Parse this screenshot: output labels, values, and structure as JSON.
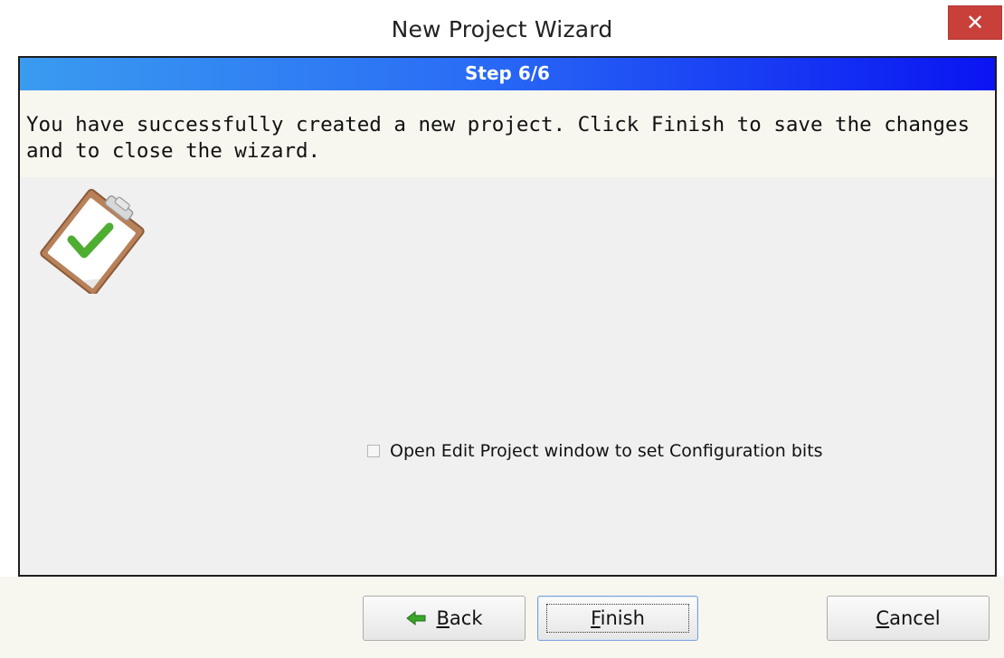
{
  "window": {
    "title": "New Project Wizard",
    "close_glyph": "✕"
  },
  "step": {
    "label": "Step 6/6"
  },
  "message": {
    "line1": "You have successfully created a new project. Click Finish to save the changes",
    "line2": "and to close the wizard."
  },
  "illustration": {
    "icon": "clipboard-check-icon"
  },
  "option": {
    "label": "Open Edit Project window to set Configuration bits",
    "checked": false
  },
  "buttons": {
    "back": {
      "mnemonic": "B",
      "rest": "ack"
    },
    "finish": {
      "mnemonic": "F",
      "rest": "inish"
    },
    "cancel": {
      "mnemonic": "C",
      "rest": "ancel"
    }
  },
  "colors": {
    "step_bar_start": "#3a9bf0",
    "step_bar_end": "#0a14f2",
    "close_button": "#c9403a",
    "check_mark": "#4fae32"
  }
}
